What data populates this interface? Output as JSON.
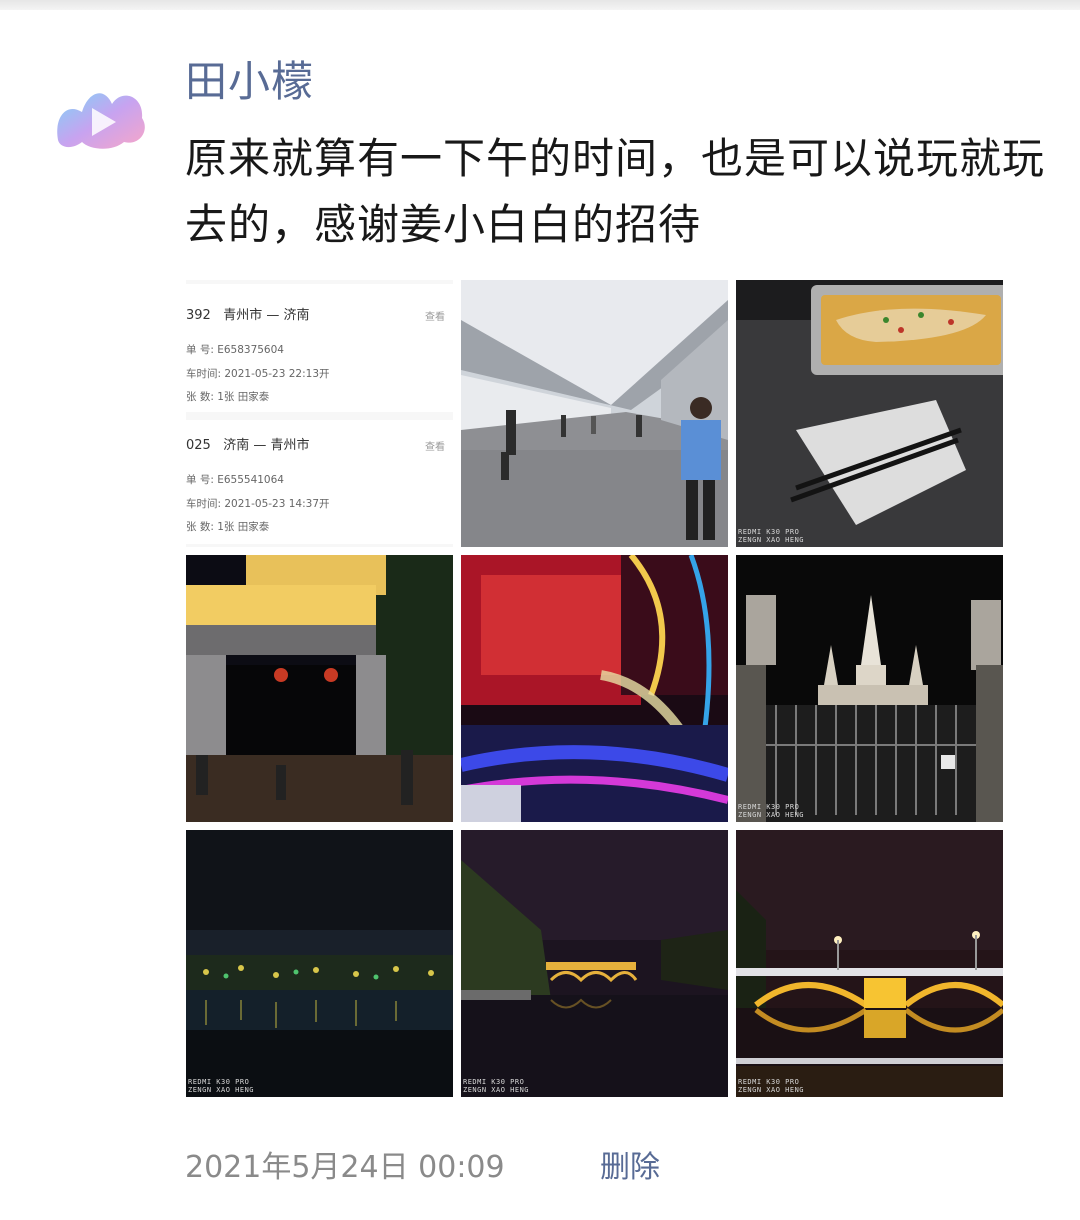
{
  "post": {
    "username": "田小檬",
    "text": "原来就算有一下午的时间，也是可以说玩就玩去的，感谢姜小白白的招待",
    "timestamp": "2021年5月24日 00:09",
    "delete_label": "删除"
  },
  "ticket": {
    "trip1": {
      "train": "392",
      "route": "青州市 — 济南",
      "view": "查看",
      "line1": "单 号:   E658375604",
      "line2": "车时间:   2021-05-23   22:13开",
      "line3": "张 数:   1张   田家泰"
    },
    "trip2": {
      "train": "025",
      "route": "济南 — 青州市",
      "view": "查看",
      "line1": "单 号:   E655541064",
      "line2": "车时间:   2021-05-23   14:37开",
      "line3": "张 数:   1张   田家泰"
    }
  },
  "watermark": {
    "line1": "REDMI K30 PRO",
    "line2": "ZENGN XAO HENG"
  }
}
